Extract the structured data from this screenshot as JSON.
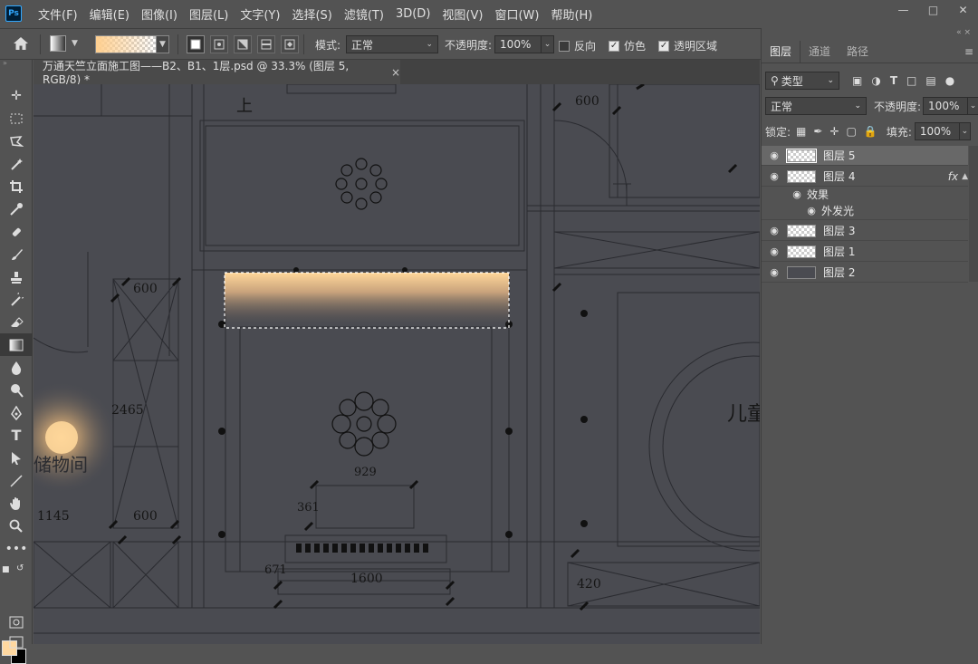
{
  "app": {
    "logo": "Ps"
  },
  "menu": [
    "文件(F)",
    "编辑(E)",
    "图像(I)",
    "图层(L)",
    "文字(Y)",
    "选择(S)",
    "滤镜(T)",
    "3D(D)",
    "视图(V)",
    "窗口(W)",
    "帮助(H)"
  ],
  "options": {
    "mode_label": "模式:",
    "mode_value": "正常",
    "opacity_label": "不透明度:",
    "opacity_value": "100%",
    "reverse_label": "反向",
    "dither_label": "仿色",
    "transparency_label": "透明区域",
    "reverse_checked": false,
    "dither_checked": true,
    "transparency_checked": true,
    "gradient_colors": [
      "#ffcf8f",
      "#ffffff"
    ]
  },
  "document": {
    "tab_title": "万通天竺立面施工图——B2、B1、1层.psd @ 33.3% (图层 5, RGB/8) *",
    "close": "×"
  },
  "drawing": {
    "dims": [
      "600",
      "600",
      "2465",
      "1145",
      "600",
      "929",
      "361",
      "1600",
      "671",
      "420"
    ],
    "room_labels": [
      "储物间",
      "儿童",
      "上"
    ]
  },
  "panel": {
    "tabs": [
      "图层",
      "通道",
      "路径"
    ],
    "filter_label": "类型",
    "blend_mode": "正常",
    "opacity_label": "不透明度:",
    "opacity_value": "100%",
    "lock_label": "锁定:",
    "fill_label": "填充:",
    "fill_value": "100%",
    "layers": [
      {
        "name": "图层 5",
        "selected": true
      },
      {
        "name": "图层 4",
        "fx": "fx"
      },
      {
        "name": "效果",
        "sub": true
      },
      {
        "name": "外发光",
        "sub2": true
      },
      {
        "name": "图层 3"
      },
      {
        "name": "图层 1"
      },
      {
        "name": "图层 2",
        "dark": true
      }
    ]
  },
  "colors": {
    "foreground": "#ffd8a0",
    "background": "#000000"
  }
}
